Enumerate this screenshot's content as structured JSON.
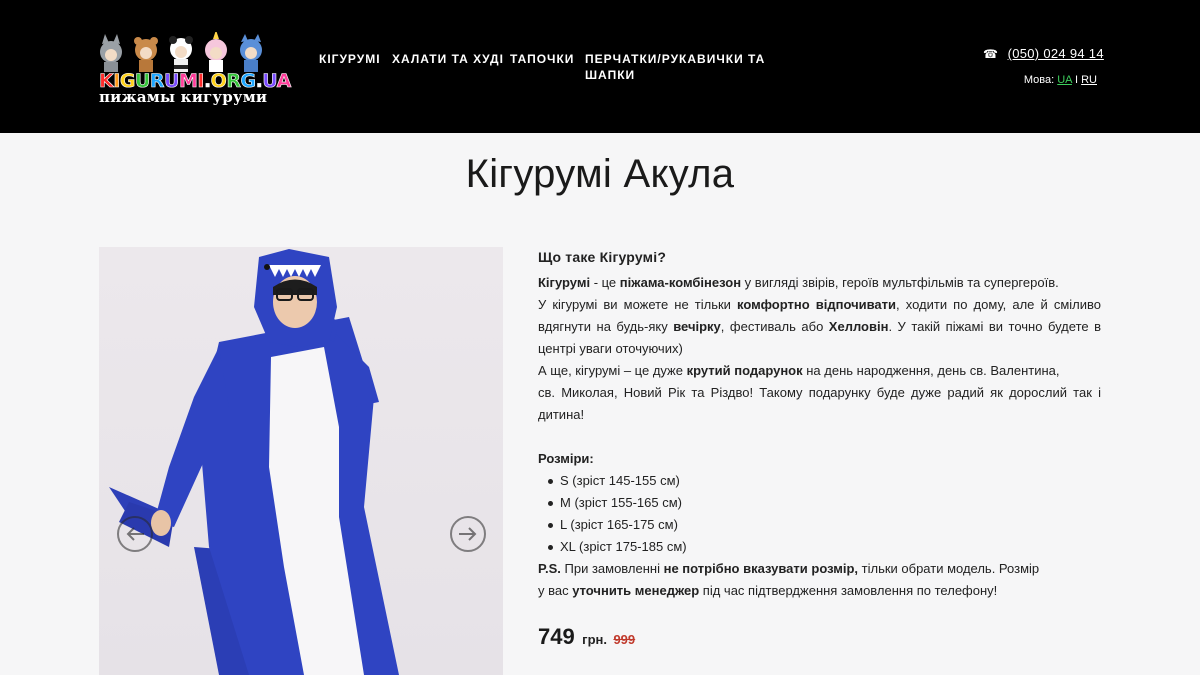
{
  "header": {
    "logo": {
      "text": "KIGURUMI.ORG.UA",
      "subtitle": "пижамы кигуруми"
    },
    "nav": [
      "КІГУРУМІ",
      "ХАЛАТИ ТА ХУДІ",
      "ТАПОЧКИ",
      "ПЕРЧАТКИ/РУКАВИЧКИ ТА",
      "ШАПКИ"
    ],
    "phone": {
      "icon": "phone-icon",
      "number": "(050) 024 94 14"
    },
    "lang": {
      "label": "Мова:",
      "options": [
        "UA",
        "RU"
      ],
      "separator": "I",
      "active": "UA",
      "active_color": "#3dd05d"
    }
  },
  "page": {
    "title": "Кігурумі Акула"
  },
  "gallery": {
    "prev_icon": "arrow-left-icon",
    "next_icon": "arrow-right-icon"
  },
  "description": {
    "heading": "Що таке Кігурумі?",
    "p1": {
      "b1": "Кігурумі",
      "t1": " - це ",
      "b2": "піжама-комбінезон",
      "t2": " у вигляді звірів, героїв мультфільмів та супергероїв."
    },
    "p2": {
      "t1": "У кігурумі ви можете не тільки ",
      "b1": "комфортно відпочивати",
      "t2": ", ходити по дому, але й сміливо вдягнути на будь-яку ",
      "b2": "вечірку",
      "t3": ", фестиваль або ",
      "b3": "Хелловін",
      "t4": ". У такій піжамі ви точно будете в центрі уваги оточуючих)"
    },
    "p3": {
      "t1": "А ще, кігурумі – це дуже ",
      "b1": "крутий подарунок",
      "t2": " на день народження, день св. Валентина,"
    },
    "p4": "св. Миколая, Новий Рік та Різдво! Такому подарунку буде дуже радий як дорослий так і дитина!",
    "sizes_title": "Розміри:",
    "sizes": [
      "S (зріст 145-155 см)",
      "M (зріст 155-165 см)",
      "L (зріст 165-175 см)",
      "XL (зріст 175-185 см)"
    ],
    "ps": {
      "b1": "P.S.",
      "t1": " При замовленні ",
      "b2": "не потрібно вказувати розмір,",
      "t2": " тільки обрати модель. Розмір"
    },
    "ps2": {
      "t1": "у вас ",
      "b1": "уточнить менеджер",
      "t2": " під час підтвердження замовлення по телефону!"
    }
  },
  "price": {
    "current": "749",
    "currency": "грн.",
    "old": "999",
    "old_color": "#c0392b"
  }
}
